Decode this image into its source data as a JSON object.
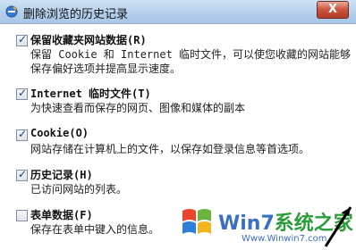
{
  "window": {
    "title": "删除浏览的历史记录",
    "close_label": "X"
  },
  "options": [
    {
      "label": "保留收藏夹网站数据(R)",
      "checked": true,
      "description": "保留 Cookie 和 Internet 临时文件，可以使您收藏的网站能够保存偏好选项并提高显示速度。"
    },
    {
      "label": "Internet 临时文件(T)",
      "checked": true,
      "description": "为快速查看而保存的网页、图像和媒体的副本"
    },
    {
      "label": "Cookie(O)",
      "checked": true,
      "description": "网站存储在计算机上的文件，以保存如登录信息等首选项。"
    },
    {
      "label": "历史记录(H)",
      "checked": true,
      "description": "已访问网站的列表。"
    },
    {
      "label": "表单数据(F)",
      "checked": false,
      "description": "保存在表单中键入的信息。"
    }
  ],
  "watermark": {
    "brand_part1": "Win7",
    "brand_part2": "系统之家",
    "url": "Www.Winwin7.com"
  },
  "icons": {
    "title_icon": "ie-delete-history-icon",
    "close_icon": "close-icon",
    "watermark_logo": "windows-flag-icon",
    "cursor": "arrow-cursor-icon"
  }
}
